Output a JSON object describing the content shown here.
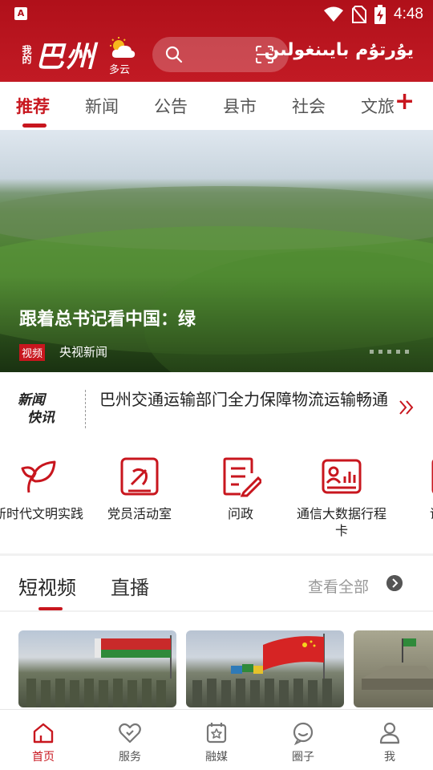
{
  "status_bar": {
    "app_icon_letter": "A",
    "time": "4:48"
  },
  "header": {
    "logo_small": "我的",
    "logo_big": "巴州",
    "weather": "多云",
    "uyghur_title": "يۇرتۇم بايىنغولىن"
  },
  "channel_tabs": [
    {
      "label": "推荐",
      "active": true
    },
    {
      "label": "新闻",
      "active": false
    },
    {
      "label": "公告",
      "active": false
    },
    {
      "label": "县市",
      "active": false
    },
    {
      "label": "社会",
      "active": false
    },
    {
      "label": "文旅",
      "active": false
    }
  ],
  "add_channel_symbol": "+",
  "hero": {
    "title": "跟着总书记看中国：绿",
    "tag": "视频",
    "source": "央视新闻"
  },
  "news_flash": {
    "logo_line1": "新闻",
    "logo_line2": "快讯",
    "text": "巴州交通运输部门全力保障物流运输畅通"
  },
  "services": [
    {
      "label": "新时代文明实践",
      "icon": "sprout-icon"
    },
    {
      "label": "党员活动室",
      "icon": "party-emblem-icon"
    },
    {
      "label": "问政",
      "icon": "edit-document-icon"
    },
    {
      "label": "通信大数据行程卡",
      "icon": "data-card-icon"
    },
    {
      "label": "话费",
      "icon": "phone-bill-icon"
    }
  ],
  "video_section": {
    "tabs": [
      {
        "label": "短视频",
        "active": true
      },
      {
        "label": "直播",
        "active": false
      }
    ],
    "see_all": "查看全部"
  },
  "bottom_nav": [
    {
      "label": "首页",
      "icon": "home-icon",
      "active": true
    },
    {
      "label": "服务",
      "icon": "heart-service-icon",
      "active": false
    },
    {
      "label": "融媒",
      "icon": "media-icon",
      "active": false
    },
    {
      "label": "圈子",
      "icon": "chat-icon",
      "active": false
    },
    {
      "label": "我",
      "icon": "user-icon",
      "active": false
    }
  ],
  "colors": {
    "brand_red": "#c8161e",
    "header_red": "#b0101a"
  }
}
